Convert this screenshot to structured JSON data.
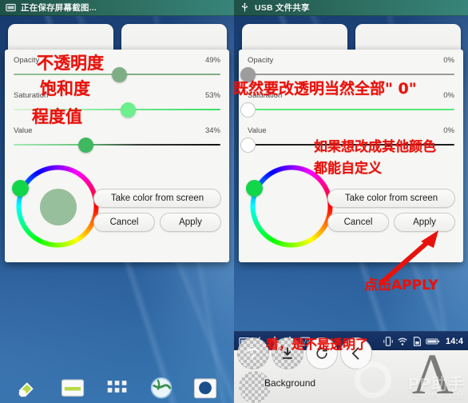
{
  "left_panel": {
    "statusbar": {
      "icon": "screenshot-icon",
      "text": "正在保存屏幕截图..."
    },
    "dialog": {
      "sliders": [
        {
          "label": "Opacity",
          "value": "49%",
          "annotation": "不透明度",
          "percent": 49
        },
        {
          "label": "Saturation",
          "value": "53%",
          "annotation": "饱和度",
          "percent": 53
        },
        {
          "label": "Value",
          "value": "34%",
          "annotation": "程度值",
          "percent": 34
        }
      ],
      "buttons": {
        "take_color": "Take color from screen",
        "cancel": "Cancel",
        "apply": "Apply"
      },
      "wheel": {
        "handle_color": "#12d64a",
        "preview_color": "#98bf9b",
        "hue_angle": 150
      }
    }
  },
  "right_panel": {
    "statusbar": {
      "icon": "usb-icon",
      "text": "USB 文件共享"
    },
    "dialog": {
      "sliders": [
        {
          "label": "Opacity",
          "value": "0%",
          "percent": 0
        },
        {
          "label": "Saturation",
          "value": "0%",
          "percent": 0
        },
        {
          "label": "Value",
          "value": "0%",
          "percent": 0
        }
      ],
      "buttons": {
        "take_color": "Take color from screen",
        "cancel": "Cancel",
        "apply": "Apply"
      },
      "wheel": {
        "handle_color": "#12d64a",
        "preview_color": "transparent",
        "hue_angle": 150
      }
    },
    "annotations": {
      "sliders_note": "既然要改透明当然全部\" 0\"",
      "custom_color_line1": "如果想改成其他颜色",
      "custom_color_line2": "都能自定义",
      "click_apply": "点击APPLY",
      "transparent_note": "看，是不是透明了"
    },
    "navbar": {
      "left_icons": [
        "screenshot-icon",
        "pen-icon",
        "usb-icon",
        "usb-icon",
        "code-icon"
      ],
      "right_icons": [
        "vibrate-icon",
        "wifi-icon",
        "sdcard-icon",
        "battery-icon"
      ],
      "time": "14:4"
    },
    "sheet": {
      "label": "Background"
    },
    "watermark": {
      "title": "PP助手",
      "url": "25PP.COM"
    }
  }
}
